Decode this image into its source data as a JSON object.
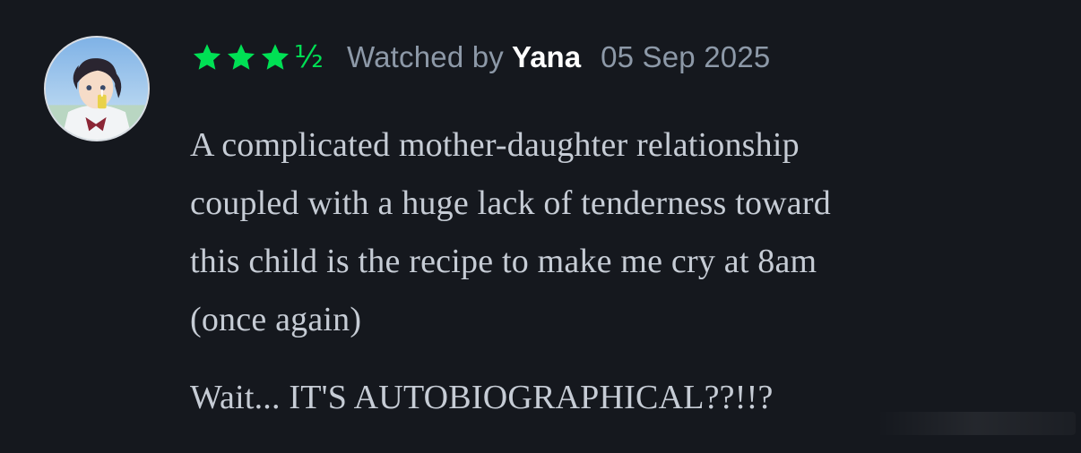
{
  "review": {
    "avatar_icon": "user-avatar-illustration",
    "rating": {
      "full_stars": 3,
      "half_star": "½",
      "star_icon": "star-icon",
      "star_color": "#00e054"
    },
    "watched_label": "Watched by",
    "username": "Yana",
    "date": "05 Sep 2025",
    "paragraph1_lines": [
      "A complicated mother-daughter relationship",
      "coupled with a huge lack of tenderness toward",
      "this child is the recipe to make me cry at 8am",
      "(once again)"
    ],
    "paragraph2": "Wait... IT'S AUTOBIOGRAPHICAL??!!?"
  },
  "colors": {
    "background": "#15181e",
    "meta_text": "#8d99a8",
    "body_text": "#c6ccd5",
    "username": "#ffffff"
  }
}
